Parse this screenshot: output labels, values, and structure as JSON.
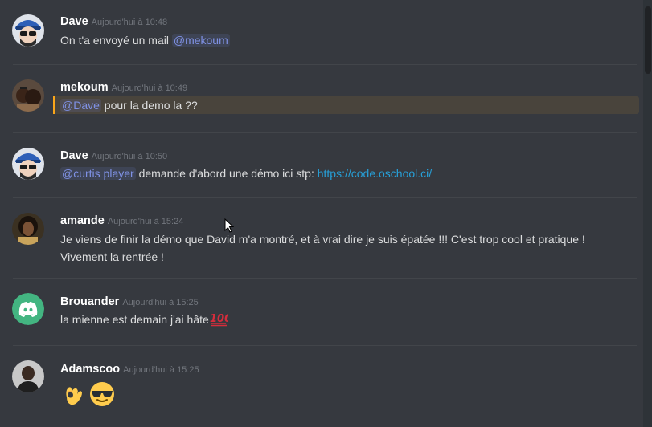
{
  "messages": [
    {
      "username": "Dave",
      "timestamp": "Aujourd'hui à 10:48",
      "avatar_icon": "dave-avatar-icon",
      "parts": [
        {
          "type": "text",
          "value": "On t'a envoyé un mail "
        },
        {
          "type": "mention",
          "value": "@mekoum"
        }
      ]
    },
    {
      "username": "mekoum",
      "timestamp": "Aujourd'hui à 10:49",
      "avatar_icon": "mekoum-avatar-icon",
      "highlighted": true,
      "parts": [
        {
          "type": "mention",
          "value": "@Dave"
        },
        {
          "type": "text",
          "value": " pour la demo la ??"
        }
      ]
    },
    {
      "username": "Dave",
      "timestamp": "Aujourd'hui à 10:50",
      "avatar_icon": "dave-avatar-icon",
      "parts": [
        {
          "type": "mention",
          "value": "@curtis player"
        },
        {
          "type": "text",
          "value": " demande d'abord une démo ici stp: "
        },
        {
          "type": "link",
          "value": "https://code.oschool.ci/"
        }
      ]
    },
    {
      "username": "amande",
      "timestamp": "Aujourd'hui à 15:24",
      "avatar_icon": "amande-avatar-icon",
      "parts": [
        {
          "type": "text",
          "value": "Je viens de finir la démo que David m'a montré, et à vrai dire je suis épatée !!! C'est trop cool et pratique ! Vivement la rentrée !"
        }
      ]
    },
    {
      "username": "Brouander",
      "timestamp": "Aujourd'hui à 15:25",
      "avatar_icon": "discord-logo-icon",
      "parts": [
        {
          "type": "text",
          "value": "la mienne est demain j'ai hâte"
        },
        {
          "type": "emoji",
          "value": "hundred-points-emoji"
        }
      ]
    },
    {
      "username": "Adamscoo",
      "timestamp": "Aujourd'hui à 15:25",
      "avatar_icon": "adamscoo-avatar-icon",
      "parts": [
        {
          "type": "emoji",
          "value": "ok-hand-emoji"
        },
        {
          "type": "emoji",
          "value": "sunglasses-emoji"
        }
      ]
    }
  ],
  "colors": {
    "background": "#36393f",
    "username": "#ffffff",
    "timestamp": "#72767d",
    "text": "#dcddde",
    "mention": "#7f91e4",
    "link": "#27a0d8",
    "highlight_bar": "#faa61a",
    "discord_green": "#43b581"
  }
}
